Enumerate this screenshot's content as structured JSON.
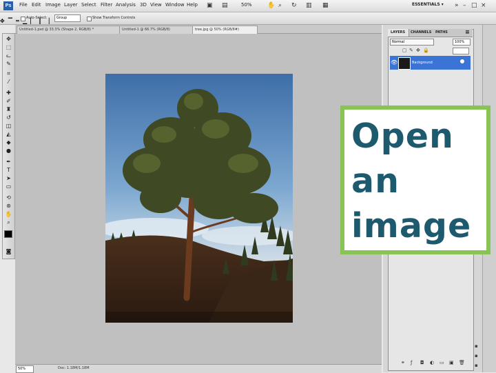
{
  "menubar": {
    "logo": "Ps",
    "items": [
      "File",
      "Edit",
      "Image",
      "Layer",
      "Select",
      "Filter",
      "Analysis",
      "3D",
      "View",
      "Window",
      "Help"
    ],
    "zoom_label": "50%",
    "workspace_label": "ESSENTIALS ▾"
  },
  "options_bar": {
    "auto_select_label": "Auto-Select:",
    "auto_select_value": "Group",
    "show_transform_label": "Show Transform Controls"
  },
  "tabs": [
    {
      "label": "Untitled-1.psd @ 33.3% (Shape 2, RGB/8) *",
      "active": false
    },
    {
      "label": "Untitled-1 @ 66.7% (RGB/8)",
      "active": false
    },
    {
      "label": "tree.jpg @ 50% (RGB/8#)",
      "active": true
    }
  ],
  "status": {
    "zoom": "50%",
    "doc_info": "Doc: 1.18M/1.18M"
  },
  "layers_panel": {
    "tabs": [
      "LAYERS",
      "CHANNELS",
      "PATHS"
    ],
    "blend_mode": "Normal",
    "opacity": "100%",
    "layer_name": "Background"
  },
  "callout": {
    "text": "Open\nan\nimage",
    "border_color": "#86c453",
    "text_color": "#1e5a6e"
  }
}
